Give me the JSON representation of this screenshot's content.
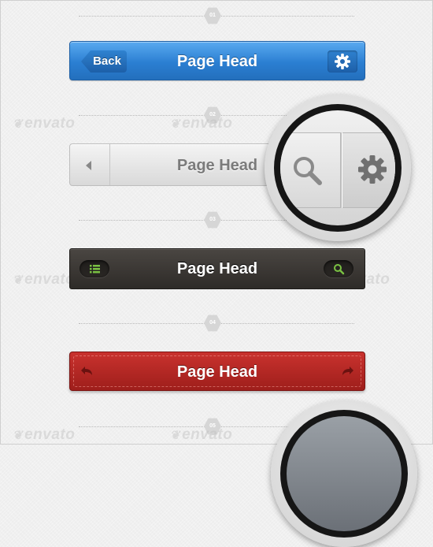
{
  "sections": [
    {
      "number": "01"
    },
    {
      "number": "02"
    },
    {
      "number": "03"
    },
    {
      "number": "04"
    },
    {
      "number": "05"
    }
  ],
  "watermark": "envato",
  "bar_blue": {
    "title": "Page Head",
    "back_label": "Back",
    "action_icon": "gear-icon",
    "color": "#2b7fd2"
  },
  "bar_grey": {
    "title": "Page Head",
    "left_icon": "caret-left-icon",
    "color": "#dcdcdc"
  },
  "magnifier": {
    "left_icon": "search-icon",
    "right_icon": "gear-icon"
  },
  "bar_dark": {
    "title": "Page Head",
    "left_icon": "list-icon",
    "right_icon": "search-icon",
    "accent": "#7ac143",
    "color": "#35312e"
  },
  "bar_red": {
    "title": "Page Head",
    "left_icon": "undo-arrow-icon",
    "right_icon": "redo-arrow-icon",
    "color": "#b52825"
  }
}
